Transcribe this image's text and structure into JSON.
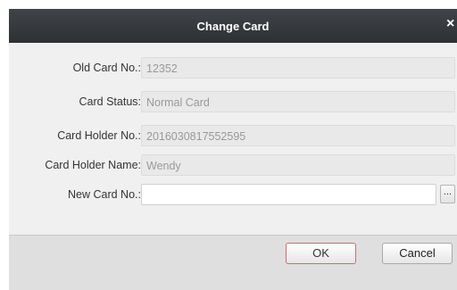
{
  "dialog": {
    "title": "Change Card",
    "close_glyph": "×"
  },
  "fields": [
    {
      "label": "Old Card No.:",
      "value": "12352"
    },
    {
      "label": "Card Status:",
      "value": "Normal Card"
    },
    {
      "label": "Card Holder No.:",
      "value": "2016030817552595"
    },
    {
      "label": "Card Holder Name:",
      "value": "Wendy"
    },
    {
      "label": "New Card No.:",
      "value": "",
      "more_button": "..."
    }
  ],
  "buttons": {
    "ok": "OK",
    "cancel": "Cancel"
  },
  "colors": {
    "titlebar": "#2e3134",
    "ok_border": "#d66a6a",
    "dialog_bg": "#f0f0f0"
  },
  "icons": {
    "close": "close-icon",
    "more": "ellipsis-icon"
  }
}
